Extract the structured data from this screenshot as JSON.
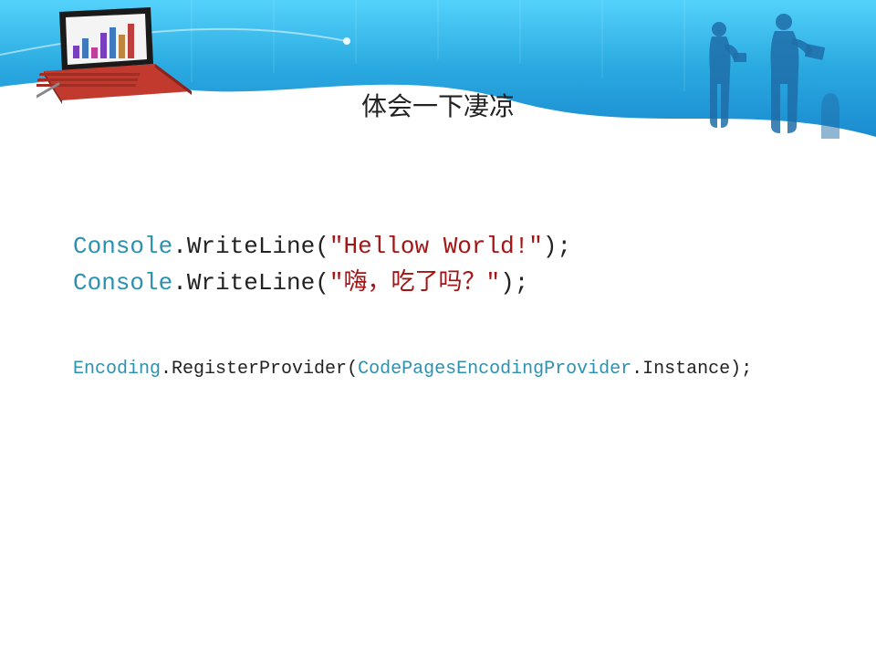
{
  "title": "体会一下凄凉",
  "code1": {
    "line1": {
      "class": "Console",
      "dot1": ".",
      "method": "WriteLine",
      "open": "(",
      "str": "\"Hellow World!\"",
      "close": ")",
      "semi": ";"
    },
    "line2": {
      "class": "Console",
      "dot1": ".",
      "method": "WriteLine",
      "open": "(",
      "str": "\"嗨，吃了吗？\"",
      "close": ")",
      "semi": ";"
    }
  },
  "code2": {
    "class1": "Encoding",
    "dot1": ".",
    "method": "RegisterProvider",
    "open": "(",
    "class2": "CodePagesEncodingProvider",
    "dot2": ".",
    "prop": "Instance",
    "close": ")",
    "semi": ";"
  },
  "colors": {
    "header_light": "#3fc6f5",
    "header_dark": "#0089d2",
    "silhouette": "#2a7db8",
    "laptop_base": "#b42d2d"
  }
}
